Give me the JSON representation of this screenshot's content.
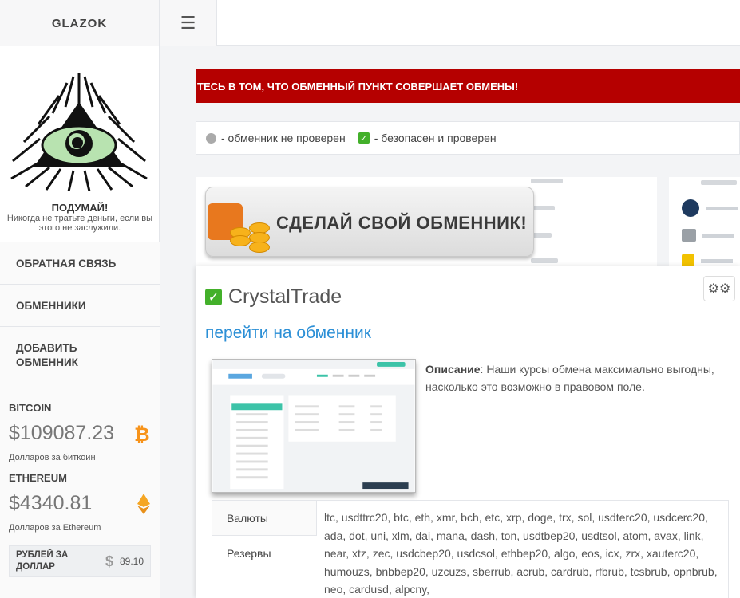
{
  "brand": "GLAZOK",
  "menu_icon": "hamburger-icon",
  "sidebar": {
    "think_title": "ПОДУМАЙ!",
    "think_sub": "Никогда не тратьте деньги, если вы этого не заслужили.",
    "nav": [
      {
        "label": "ОБРАТНАЯ СВЯЗЬ"
      },
      {
        "label": "ОБМЕННИКИ"
      },
      {
        "label": "ДОБАВИТЬ ОБМЕННИК"
      }
    ],
    "bitcoin": {
      "name": "BITCOIN",
      "price": "$109087.23",
      "caption": "Долларов за биткоин",
      "icon": "bitcoin-icon",
      "color": "#f7931a"
    },
    "ethereum": {
      "name": "ETHEREUM",
      "price": "$4340.81",
      "caption": "Долларов за Ethereum",
      "icon": "ethereum-icon",
      "color": "#f5a623"
    },
    "rub": {
      "label": "РУБЛЕЙ ЗА ДОЛЛАР",
      "sign": "$",
      "value": "89.10"
    }
  },
  "alert": "ТЕСЬ В ТОМ, ЧТО ОБМЕННЫЙ ПУНКТ СОВЕРШАЕТ ОБМЕНЫ!",
  "legend": {
    "unchecked": "- обменник не проверен",
    "checked": "- безопасен и проверен"
  },
  "promo": {
    "text": "СДЕЛАЙ СВОЙ ОБМЕННИК!"
  },
  "exchanger": {
    "name": "CrystalTrade",
    "link": "перейти на обменник",
    "desc_label": "Описание",
    "desc_text": ": Наши курсы обмена максимально выгодны, насколько это возможно в правовом поле.",
    "tabs": [
      {
        "label": "Валюты"
      },
      {
        "label": "Резервы"
      }
    ],
    "currencies": "ltc, usdttrc20, btc, eth, xmr, bch, etc, xrp, doge, trx, sol, usdterc20, usdcerc20, ada, dot, uni, xlm, dai, mana, dash, ton, usdtbep20, usdtsol, atom, avax, link, near, xtz, zec, usdcbep20, usdcsol, ethbep20, algo, eos, icx, zrx, xauterc20, humouzs, bnbbep20, uzcuzs, sberrub, acrub, cardrub, rfbrub, tcsbrub, opnbrub, neo, cardusd, alpcny,"
  },
  "colors": {
    "alert": "#b50000",
    "verified": "#43b02a",
    "link": "#2b8fd6"
  }
}
